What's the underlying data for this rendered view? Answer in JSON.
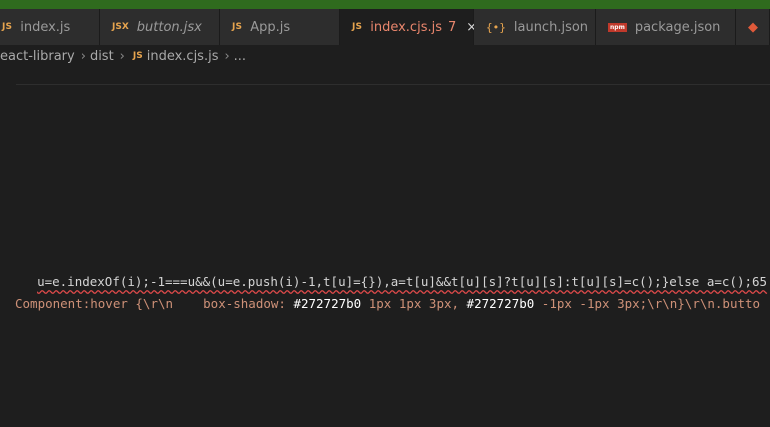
{
  "tabs": [
    {
      "icon": "js-icon",
      "icon_text": "JS",
      "label": "index.js"
    },
    {
      "icon": "jsx-icon",
      "icon_text": "JSX",
      "label": "button.jsx"
    },
    {
      "icon": "js-icon",
      "icon_text": "JS",
      "label": "App.js"
    },
    {
      "icon": "js-icon",
      "icon_text": "JS",
      "label": "index.cjs.js",
      "badge": "7",
      "close": "×",
      "active": true
    },
    {
      "icon": "json-icon",
      "icon_text": "{•}",
      "label": "launch.json"
    },
    {
      "icon": "npm-icon",
      "icon_text": "npm",
      "label": "package.json"
    },
    {
      "icon": "git-icon",
      "icon_text": "◆",
      "label": ""
    }
  ],
  "breadcrumb": [
    "eact-library",
    "dist",
    "index.cjs.js",
    "..."
  ],
  "breadcrumb_js_icon": "JS",
  "code": {
    "line1": "u=e.indexOf(i);-1===u&&(u=e.push(i)-1,t[u]={}),a=t[u]&&t[u][s]?t[u][s]:t[u][s]=c();}else a=c();65",
    "line2_a": "Component:hover {\\r\\n    box-shadow: ",
    "line2_b": "#272727b0",
    "line2_c": " 1px 1px 3px, ",
    "line2_d": "#272727b0",
    "line2_e": " -1px -1px 3px;\\r\\n}\\r\\n.butto"
  },
  "colors": {
    "title_bar": "#2f6b1e",
    "active_tab_text": "#e9866d",
    "squiggle": "#e04a4a"
  }
}
